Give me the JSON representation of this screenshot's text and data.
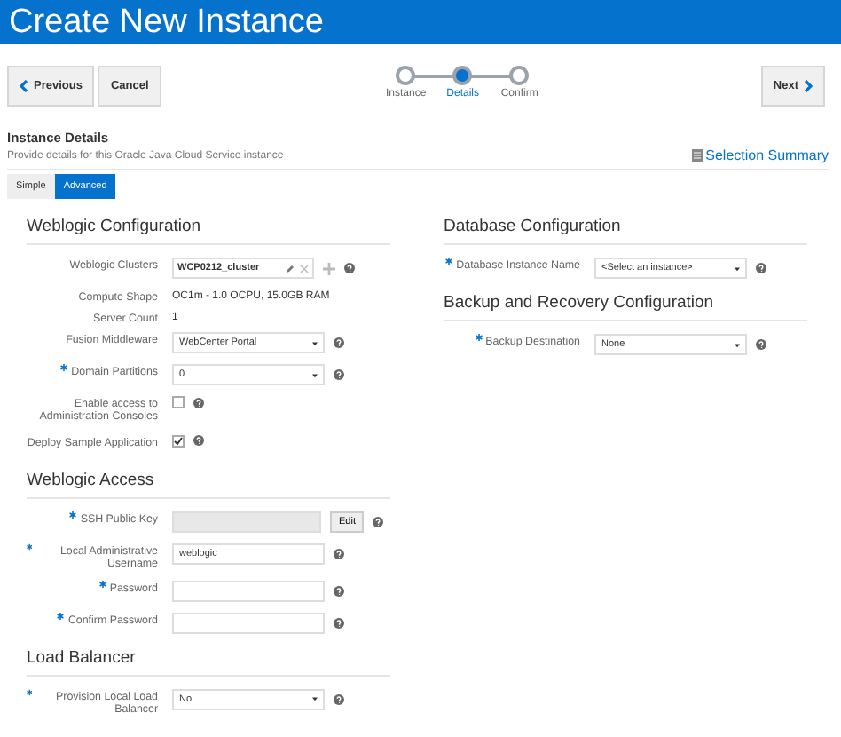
{
  "header": {
    "title": "Create New Instance"
  },
  "nav": {
    "previous": "Previous",
    "cancel": "Cancel",
    "next": "Next"
  },
  "train": [
    {
      "label": "Instance",
      "selected": false
    },
    {
      "label": "Details",
      "selected": true
    },
    {
      "label": "Confirm",
      "selected": false
    }
  ],
  "details": {
    "title": "Instance Details",
    "subtitle": "Provide details for this Oracle Java Cloud Service instance",
    "link": "Selection Summary"
  },
  "tabs": [
    {
      "label": "Simple",
      "selected": false
    },
    {
      "label": "Advanced",
      "selected": true
    }
  ],
  "columns": [
    [
      {
        "title": "Weblogic Configuration",
        "fields": [
          {
            "kind": "cluster",
            "label": "Weblogic Clusters",
            "required": false,
            "value": "WCP0212_cluster",
            "help": true
          },
          {
            "kind": "text",
            "label": "Compute Shape",
            "required": false,
            "value": "OC1m - 1.0 OCPU, 15.0GB RAM",
            "help": false
          },
          {
            "kind": "text",
            "label": "Server Count",
            "required": false,
            "value": "1",
            "help": false
          },
          {
            "kind": "select",
            "label": "Fusion Middleware",
            "required": false,
            "value": "WebCenter Portal",
            "help": true
          },
          {
            "kind": "select",
            "label": "Domain Partitions",
            "required": true,
            "value": "0",
            "help": true
          },
          {
            "kind": "checkbox",
            "label": "Enable access to Administration Consoles",
            "required": false,
            "checked": false,
            "help": true
          },
          {
            "kind": "checkbox",
            "label": "Deploy Sample Application",
            "required": false,
            "checked": true,
            "help": true
          }
        ]
      },
      {
        "title": "Weblogic Access",
        "fields": [
          {
            "kind": "key",
            "label": "SSH Public Key",
            "required": true,
            "button": "Edit",
            "help": true
          },
          {
            "kind": "input",
            "label": "Local Administrative Username",
            "required": true,
            "value": "weblogic",
            "help": true
          },
          {
            "kind": "input",
            "label": "Password",
            "required": true,
            "help": true
          },
          {
            "kind": "input",
            "label": "Confirm Password",
            "required": true,
            "help": true
          }
        ]
      },
      {
        "title": "Load Balancer",
        "fields": [
          {
            "kind": "select",
            "label": "Provision Local Load Balancer",
            "required": true,
            "value": "No",
            "help": true
          }
        ]
      }
    ],
    [
      {
        "title": "Database Configuration",
        "fields": [
          {
            "kind": "select",
            "label": "Database Instance Name",
            "required": true,
            "value": "<Select an instance>",
            "help": true
          }
        ]
      },
      {
        "title": "Backup and Recovery Configuration",
        "fields": [
          {
            "kind": "select",
            "label": "Backup Destination",
            "required": true,
            "value": "None",
            "help": true
          }
        ]
      }
    ]
  ]
}
